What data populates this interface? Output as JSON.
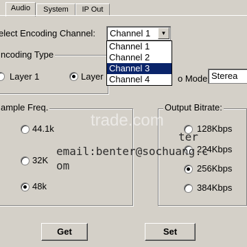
{
  "tabs": [
    "Audio",
    "System",
    "IP Out"
  ],
  "encoding_channel": {
    "label": "elect Encoding Channel:",
    "value": "Channel 1",
    "options": [
      "Channel 1",
      "Channel 2",
      "Channel 3",
      "Channel 4"
    ],
    "highlighted": "Channel 3"
  },
  "encoding_type": {
    "title": "ncoding Type",
    "options": [
      "Layer 1",
      "Layer"
    ]
  },
  "mode": {
    "label": "o Mode",
    "value": "Sterea"
  },
  "sample_freq": {
    "title": "ample Freq.",
    "options": [
      "44.1k",
      "32K",
      "48k"
    ],
    "selected": "48k"
  },
  "output_bitrate": {
    "title": "Output Bitrate:",
    "options": [
      "128Kbps",
      "224Kbps",
      "256Kbps",
      "384Kbps"
    ],
    "selected": "256Kbps"
  },
  "watermark": {
    "line1": "ter",
    "line2": "email:benter@sochuang.c",
    "line3": "om",
    "site": "trade.com"
  },
  "buttons": {
    "get": "Get",
    "set": "Set"
  }
}
